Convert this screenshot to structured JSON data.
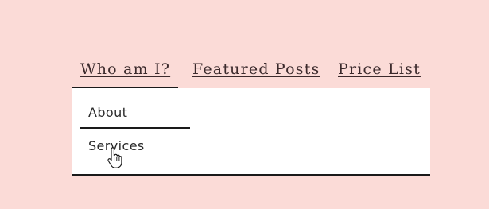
{
  "nav": {
    "tabs": [
      {
        "label": "Who am I?",
        "active": true
      },
      {
        "label": "Featured Posts",
        "active": false
      },
      {
        "label": "Price List",
        "active": false
      }
    ]
  },
  "dropdown": {
    "items": [
      {
        "label": "About"
      },
      {
        "label": "Services"
      }
    ]
  },
  "cursor": {
    "icon": "hand-pointer-icon"
  },
  "colors": {
    "background": "#fbdbd7",
    "panel": "#ffffff",
    "text": "#3b2a2c",
    "line": "#1a1a1a"
  }
}
